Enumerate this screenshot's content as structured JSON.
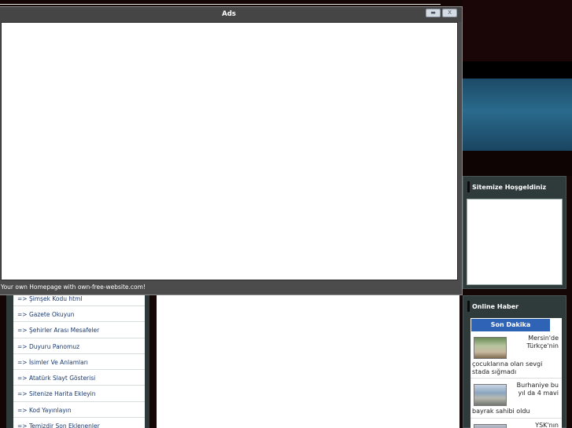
{
  "popup": {
    "title": "Ads",
    "minimize_label": "▬",
    "close_label": "X",
    "footer_text": "Your own Homepage with own-free-website.com!"
  },
  "right_sidebar": {
    "welcome_widget": {
      "title": "Sitemize Hoşgeldiniz"
    },
    "news_widget": {
      "title": "Online Haber",
      "header": "Son Dakika",
      "items": [
        {
          "title": "Mersin'de Türkçe'nin",
          "continuation": "çocuklarına olan sevgi stada sığmadı"
        },
        {
          "title": "Burhaniye bu yıl da 4 mavi",
          "continuation": "bayrak sahibi oldu"
        },
        {
          "title": "YSK'nın",
          "continuation": ""
        }
      ]
    }
  },
  "left_menu": {
    "items": [
      "=> Şimşek Kodu html",
      "=> Gazete Okuyun",
      "=> Şehirler Arası Mesafeler",
      "=> Duyuru Panomuz",
      "=> İsimler Ve Anlamları",
      "=> Atatürk Slayt Gösterisi",
      "=> Sitenize Harita Ekleyin",
      "=> Kod Yayınlayın",
      "=> Temizdir Son Eklenenler"
    ]
  },
  "colors": {
    "sidebar_frame": "#2f3a3b",
    "son_dakika_blue": "#2e63b5",
    "menu_link": "#1a3a6e",
    "popup_gray": "#4c4c4c"
  }
}
